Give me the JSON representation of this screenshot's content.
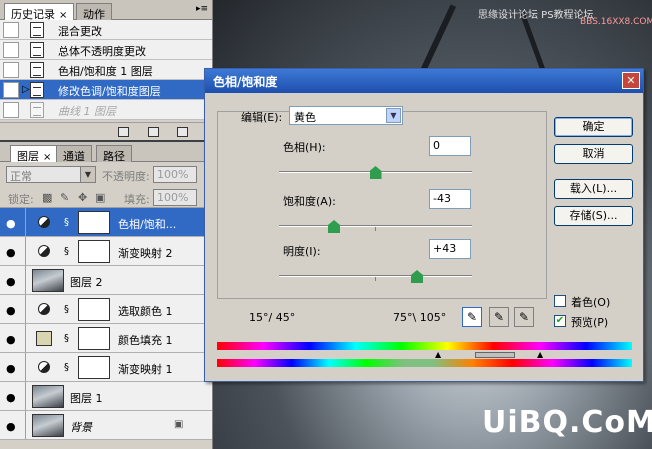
{
  "history_panel": {
    "tabs": [
      {
        "label": "历史记录",
        "close": "×"
      },
      {
        "label": "动作"
      }
    ],
    "items": [
      {
        "label": "混合更改"
      },
      {
        "label": "总体不透明度更改"
      },
      {
        "label": "色相/饱和度 1 图层"
      },
      {
        "label": "修改色调/饱和度图层"
      },
      {
        "label": "曲线 1 图层"
      }
    ],
    "menu_glyph": "▸≡"
  },
  "layers_panel": {
    "tabs": [
      {
        "label": "图层",
        "close": "×"
      },
      {
        "label": "通道"
      },
      {
        "label": "路径"
      }
    ],
    "blend_mode": "正常",
    "opacity_label": "不透明度:",
    "opacity_value": "100%",
    "lock_label": "锁定:",
    "fill_label": "填充:",
    "fill_value": "100%",
    "layers": [
      {
        "name": "色相/饱和..."
      },
      {
        "name": "渐变映射 2"
      },
      {
        "name": "图层 2"
      },
      {
        "name": "选取颜色 1"
      },
      {
        "name": "颜色填充 1"
      },
      {
        "name": "渐变映射 1"
      },
      {
        "name": "图层 1"
      },
      {
        "name": "背景"
      }
    ]
  },
  "dialog": {
    "title": "色相/饱和度",
    "close": "✕",
    "edit_label": "编辑(E):",
    "edit_value": "黄色",
    "hue_label": "色相(H):",
    "hue_value": "0",
    "sat_label": "饱和度(A):",
    "sat_value": "-43",
    "light_label": "明度(I):",
    "light_value": "+43",
    "range_left": "15°/ 45°",
    "range_right": "75°\\ 105°",
    "buttons": {
      "ok": "确定",
      "cancel": "取消",
      "load": "载入(L)...",
      "save": "存储(S)..."
    },
    "colorize_label": "着色(O)",
    "preview_label": "预览(P)",
    "preview_checked": true,
    "colorize_checked": false,
    "slider_levels": {
      "hue": 0,
      "saturation": -43,
      "lightness": 43
    }
  },
  "watermarks": {
    "top": "思缘设计论坛  PS教程论坛",
    "top2": "BBS.16XX8.COM",
    "bottom": "UiBQ.CoM"
  }
}
